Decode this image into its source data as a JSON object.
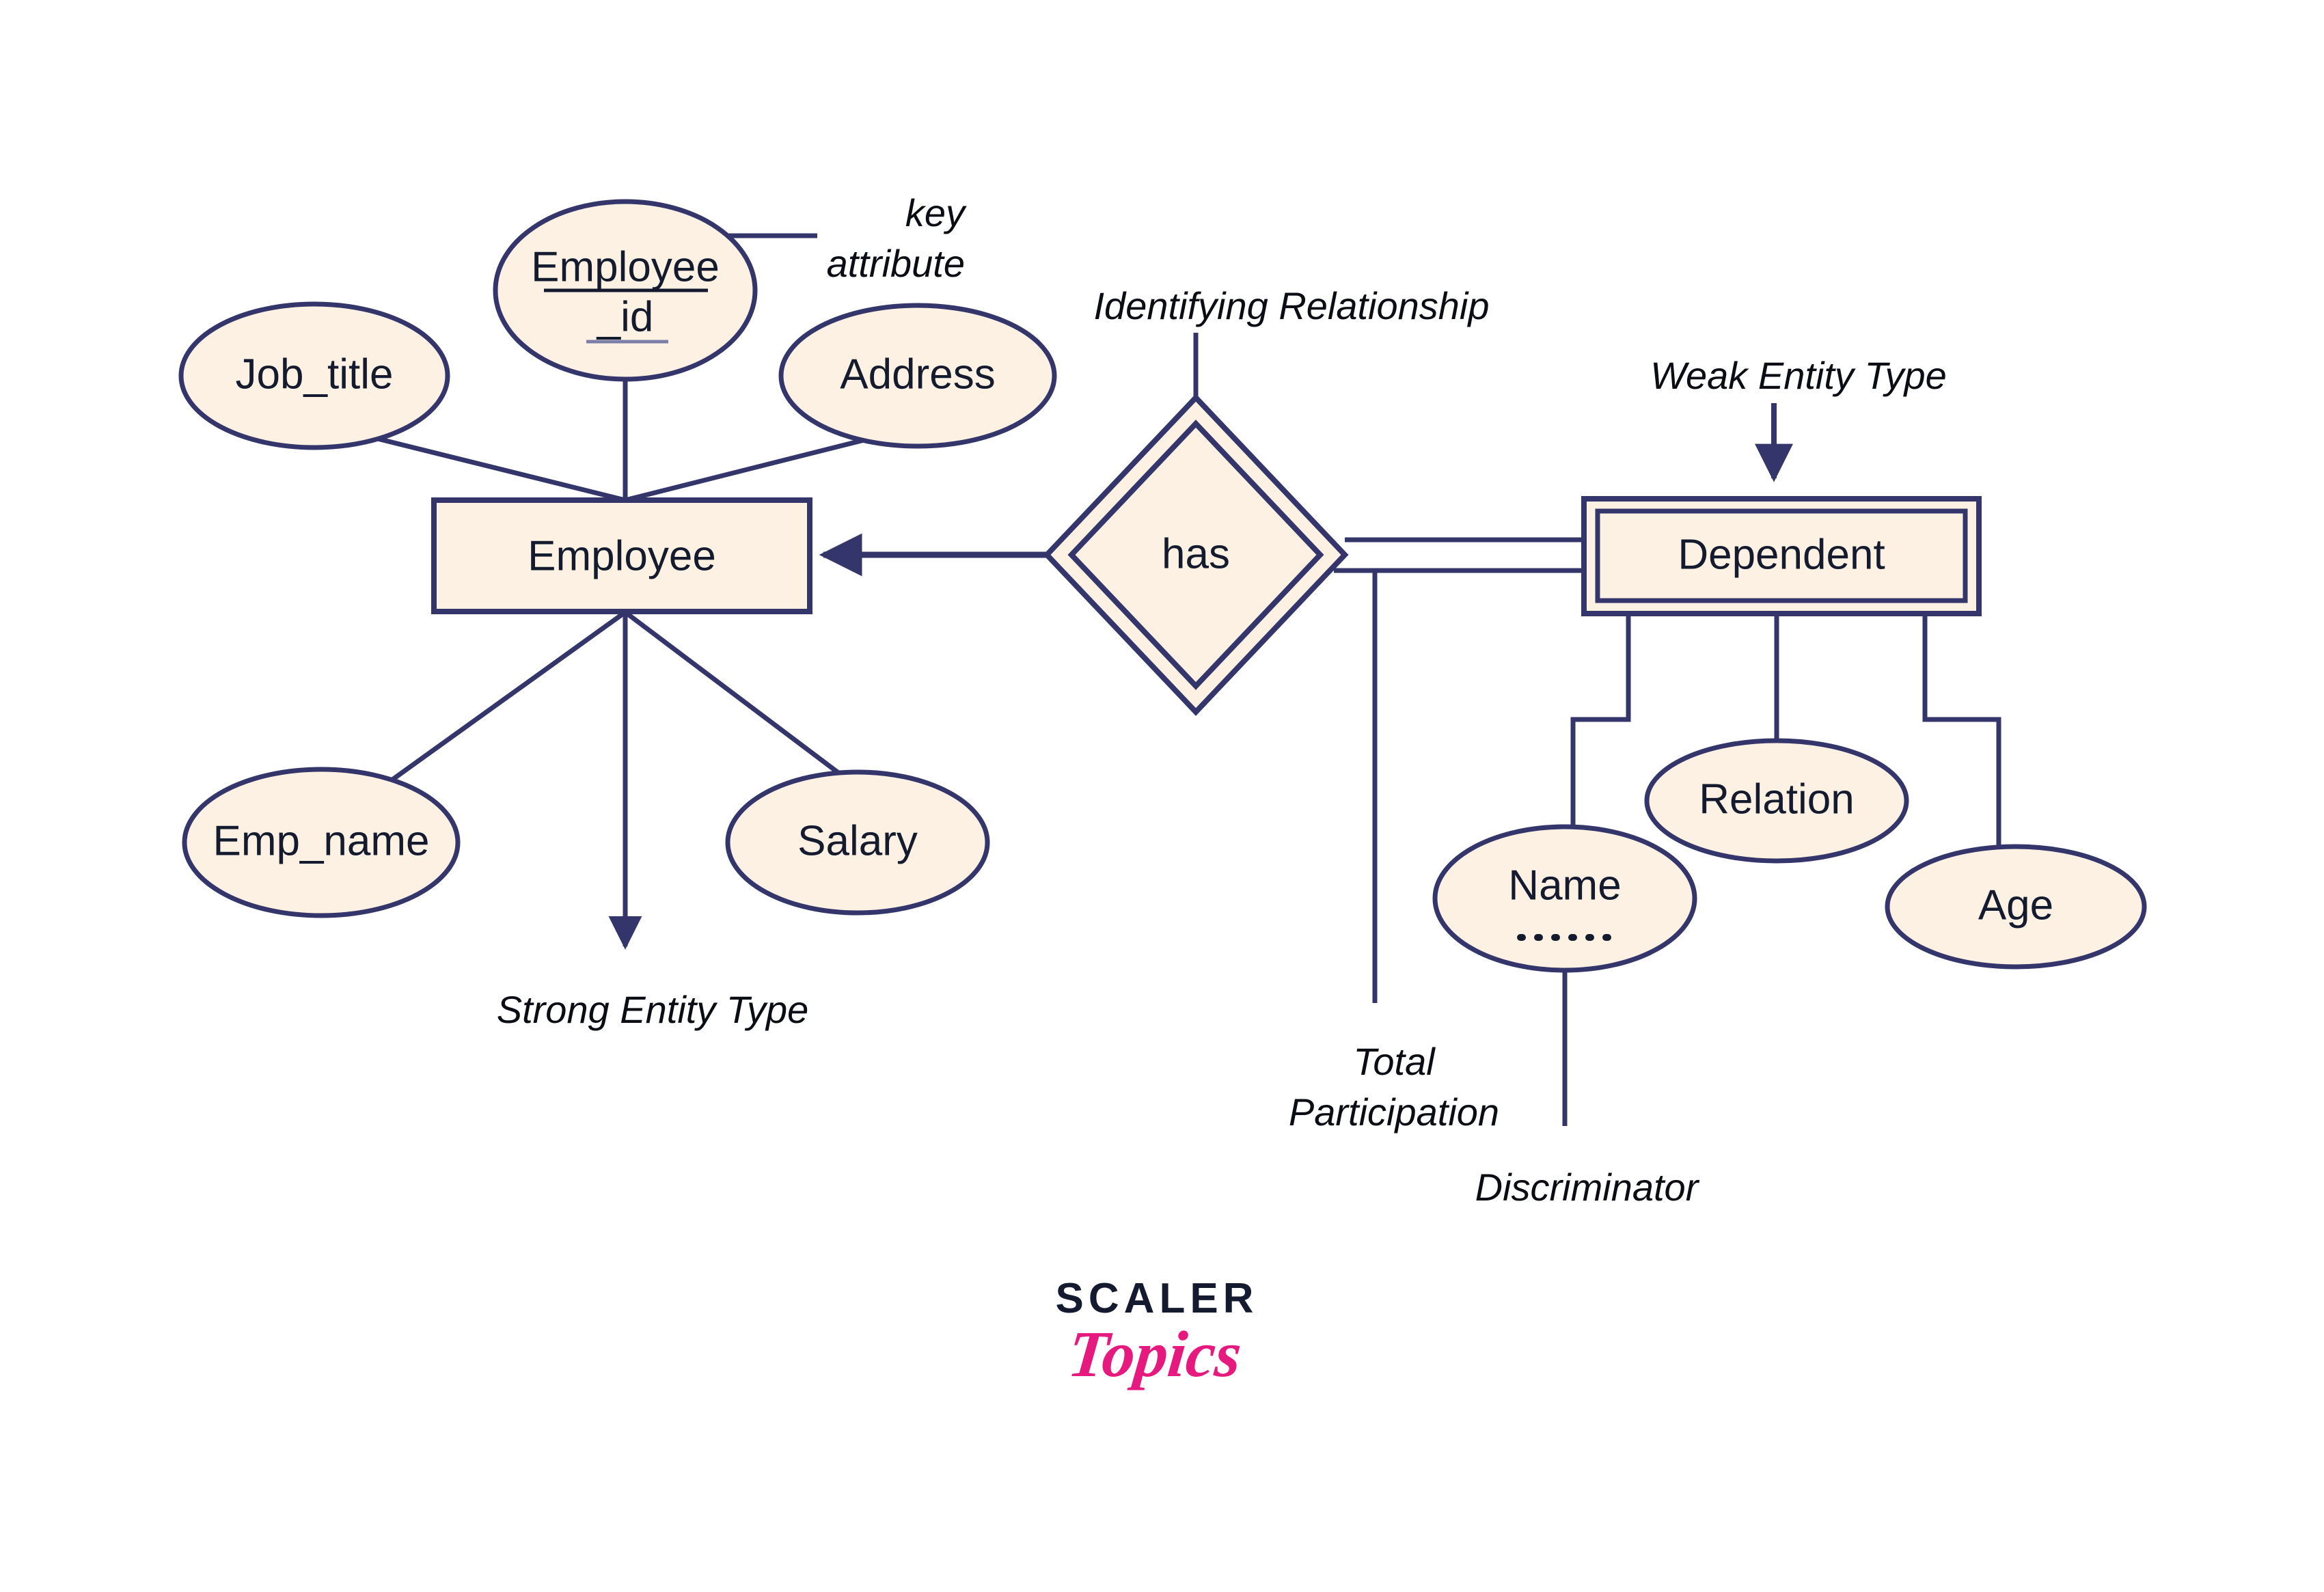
{
  "diagram": {
    "title_present": false,
    "colors": {
      "stroke": "#34356B",
      "fill": "#FDF1E3",
      "text": "#151B2E",
      "annotation_text": "#0B0D14",
      "background": "#FFFFFF",
      "logo_pink": "#E6197F",
      "logo_dark": "#151B2E"
    },
    "entities": [
      {
        "id": "employee",
        "label": "Employee",
        "type": "strong-entity"
      },
      {
        "id": "dependent",
        "label": "Dependent",
        "type": "weak-entity"
      }
    ],
    "relationships": [
      {
        "id": "has",
        "label": "has",
        "type": "identifying-relationship"
      }
    ],
    "employee_attributes": [
      {
        "id": "employee_id",
        "label_line1": "Employee",
        "label_line2": "_id",
        "key": true
      },
      {
        "id": "job_title",
        "label": "Job_title",
        "key": false
      },
      {
        "id": "address",
        "label": "Address",
        "key": false
      },
      {
        "id": "emp_name",
        "label": "Emp_name",
        "key": false
      },
      {
        "id": "salary",
        "label": "Salary",
        "key": false
      }
    ],
    "dependent_attributes": [
      {
        "id": "name",
        "label": "Name",
        "discriminator": true
      },
      {
        "id": "relation",
        "label": "Relation",
        "discriminator": false
      },
      {
        "id": "age",
        "label": "Age",
        "discriminator": false
      }
    ],
    "annotations": [
      {
        "id": "key-attribute",
        "line1": "key",
        "line2": "attribute"
      },
      {
        "id": "identifying-relationship",
        "text": "Identifying Relationship"
      },
      {
        "id": "weak-entity-type",
        "text": "Weak Entity Type"
      },
      {
        "id": "strong-entity-type",
        "text": "Strong Entity Type"
      },
      {
        "id": "total-participation",
        "line1": "Total",
        "line2": "Participation"
      },
      {
        "id": "discriminator",
        "text": "Discriminator"
      }
    ]
  },
  "logo": {
    "primary": "SCALER",
    "secondary": "Topics"
  }
}
